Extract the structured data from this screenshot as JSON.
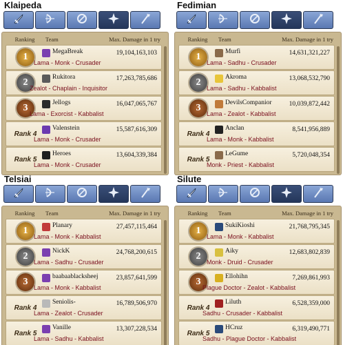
{
  "columns": {
    "ranking": "Ranking",
    "team": "Team",
    "damage": "Max. Damage in 1 try"
  },
  "tabs": [
    "sword-icon",
    "bow-icon",
    "shield-icon",
    "cross-icon",
    "staff-icon"
  ],
  "colors": {
    "tab_active": "#2d4268",
    "tab": "#6f8cc4",
    "board": "#c9b891",
    "class_text": "#7a0f1e"
  },
  "servers": [
    {
      "name": "Klaipeda",
      "rows": [
        {
          "rank": "1",
          "team": "MegaBreak",
          "damage": "19,104,163,103",
          "classes": "Lama - Monk - Crusader",
          "avatar": "#7b3fb0"
        },
        {
          "rank": "2",
          "team": "Rukitora",
          "damage": "17,263,785,686",
          "classes": "Zealot - Chaplain - Inquisitor",
          "avatar": "#5a5a5a"
        },
        {
          "rank": "3",
          "team": "Jellogs",
          "damage": "16,047,065,767",
          "classes": "Lama - Exorcist - Kabbalist",
          "avatar": "#2b2b2b"
        },
        {
          "rank": "Rank 4",
          "team": "Valenstein",
          "damage": "15,587,616,309",
          "classes": "Lama - Monk - Crusader",
          "avatar": "#6c3ab0"
        },
        {
          "rank": "Rank 5",
          "team": "Heroes",
          "damage": "13,604,339,384",
          "classes": "Lama - Monk - Crusader",
          "avatar": "#1e1e1e"
        }
      ]
    },
    {
      "name": "Fedimian",
      "rows": [
        {
          "rank": "1",
          "team": "Murfi",
          "damage": "14,631,321,227",
          "classes": "Lama - Sadhu - Crusader",
          "avatar": "#8a6a4a"
        },
        {
          "rank": "2",
          "team": "Akroma",
          "damage": "13,068,532,790",
          "classes": "Lama - Sadhu - Kabbalist",
          "avatar": "#e8c53a"
        },
        {
          "rank": "3",
          "team": "DevilsCompanior",
          "damage": "10,039,872,442",
          "classes": "Lama - Zealot - Kabbalist",
          "avatar": "#c07a3a"
        },
        {
          "rank": "Rank 4",
          "team": "Anclan",
          "damage": "8,541,956,889",
          "classes": "Lama - Monk - Kabbalist",
          "avatar": "#222222"
        },
        {
          "rank": "Rank 5",
          "team": "LeGume",
          "damage": "5,720,048,354",
          "classes": "Monk - Priest - Kabbalist",
          "avatar": "#8a6a4a"
        }
      ]
    },
    {
      "name": "Telsiai",
      "rows": [
        {
          "rank": "1",
          "team": "Planary",
          "damage": "27,457,115,464",
          "classes": "Lama - Monk - Kabbalist",
          "avatar": "#c23a3a"
        },
        {
          "rank": "2",
          "team": "NickK",
          "damage": "24,768,200,615",
          "classes": "Lama - Sadhu - Crusader",
          "avatar": "#7b3fb0"
        },
        {
          "rank": "3",
          "team": "baabaablacksheej",
          "damage": "23,857,641,599",
          "classes": "Lama - Monk - Kabbalist",
          "avatar": "#7b3fb0"
        },
        {
          "rank": "Rank 4",
          "team": "Seniolis-",
          "damage": "16,789,506,970",
          "classes": "Lama - Zealot - Crusader",
          "avatar": "#b9b9b9"
        },
        {
          "rank": "Rank 5",
          "team": "Vanille",
          "damage": "13,307,228,534",
          "classes": "Lama - Sadhu - Kabbalist",
          "avatar": "#7b3fb0"
        }
      ]
    },
    {
      "name": "Silute",
      "rows": [
        {
          "rank": "1",
          "team": "SukiKioshi",
          "damage": "21,768,795,345",
          "classes": "Lama - Monk - Kabbalist",
          "avatar": "#2a4a7a"
        },
        {
          "rank": "2",
          "team": "Aiky",
          "damage": "12,683,802,839",
          "classes": "Monk - Druid - Crusader",
          "avatar": "#d8c040"
        },
        {
          "rank": "3",
          "team": "Ellohihn",
          "damage": "7,269,861,993",
          "classes": "Plague Doctor - Zealot - Kabbalist",
          "avatar": "#d8b020"
        },
        {
          "rank": "Rank 4",
          "team": "Liluth",
          "damage": "6,528,359,000",
          "classes": "Sadhu - Crusader - Kabbalist",
          "avatar": "#a02020"
        },
        {
          "rank": "Rank 5",
          "team": "HCruz",
          "damage": "6,319,490,771",
          "classes": "Sadhu - Plague Doctor - Kabbalist",
          "avatar": "#2a4a7a"
        }
      ]
    }
  ]
}
